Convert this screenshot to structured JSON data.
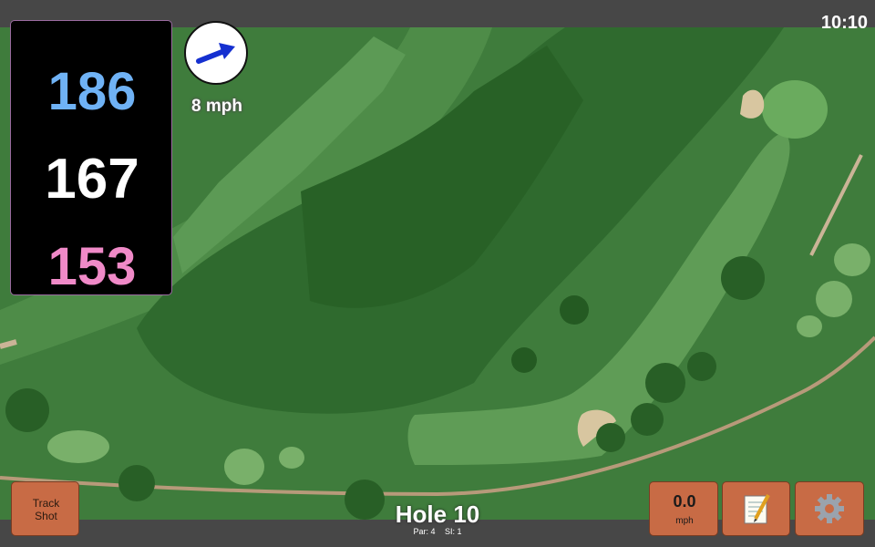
{
  "status": {
    "time": "10:10"
  },
  "yardages": {
    "back": "186",
    "middle": "167",
    "front": "153"
  },
  "wind": {
    "speed": "8 mph",
    "icon": "wind-arrow-icon"
  },
  "buttons": {
    "track_shot": "Track\nShot",
    "speed_value": "0.0",
    "speed_unit": "mph",
    "notes_icon": "notepad-icon",
    "settings_icon": "gear-icon"
  },
  "hole": {
    "title": "Hole 10",
    "par": "Par: 4",
    "si": "SI: 1"
  },
  "colors": {
    "back": "#6fb2f5",
    "middle": "#ffffff",
    "front": "#f08ac8",
    "button": "#c86b45"
  }
}
